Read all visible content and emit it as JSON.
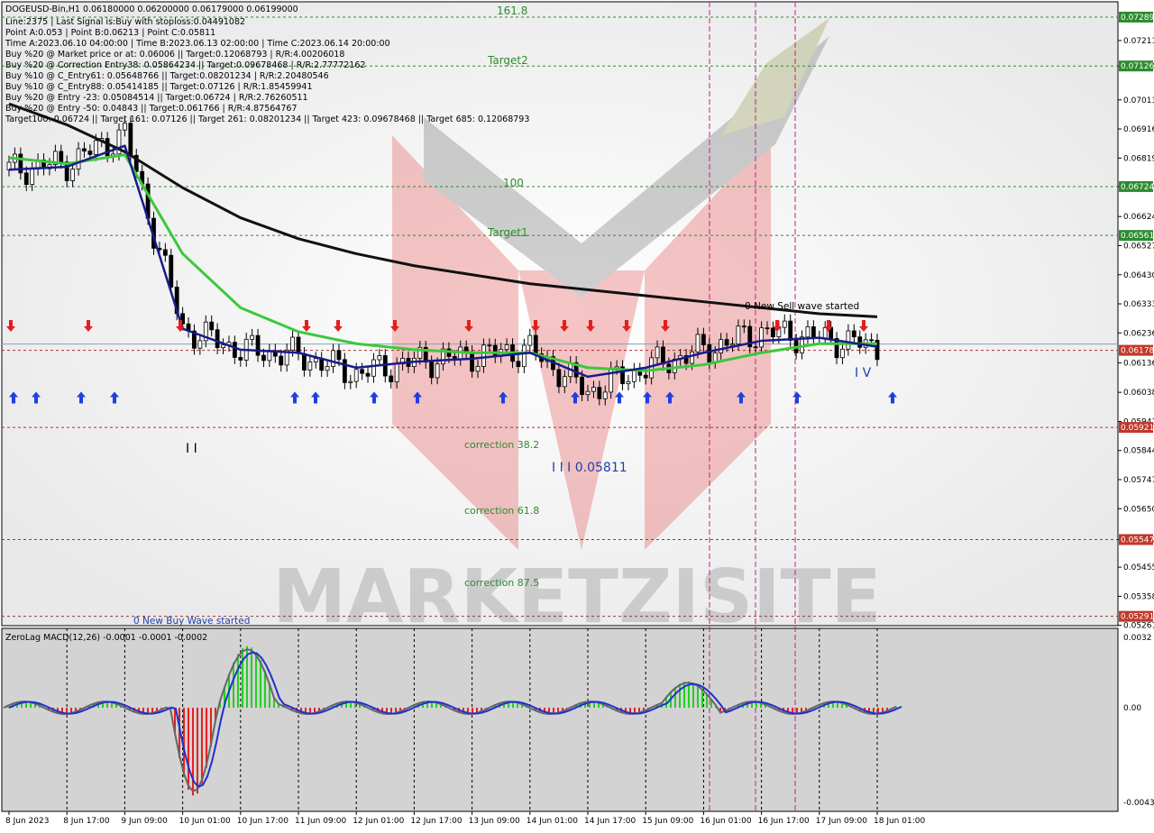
{
  "header": {
    "symbol_line": "DOGEUSD-Bin,H1  0.06180000 0.06200000 0.06179000 0.06199000",
    "lines": [
      "Line:2375 | Last Signal is:Buy with stoploss:0.04491082",
      "Point A:0.053 | Point B:0.06213 | Point C:0.05811",
      "Time A:2023.06.10 04:00:00 | Time B:2023.06.13 02:00:00 | Time C:2023.06.14 20:00:00",
      "Buy %20 @ Market price or at: 0.06006 || Target:0.12068793 | R/R:4.00206018",
      "Buy %20 @ Correction Entry38: 0.05864234 || Target:0.09678468 | R/R:2.77772162",
      "Buy %10 @ C_Entry61: 0.05648766 || Target:0.08201234 | R/R:2.20480546",
      "Buy %10 @ C_Entry88: 0.05414185 || Target:0.07126 | R/R:1.85459941",
      "Buy %20 @ Entry -23: 0.05084514 || Target:0.06724 | R/R:2.76260511",
      "Buy %20 @ Entry -50: 0.04843 || Target:0.061766 | R/R:4.87564767",
      "Target100: 0.06724 || Target 161: 0.07126 || Target 261: 0.08201234 || Target 423: 0.09678468 || Target 685: 0.12068793"
    ]
  },
  "watermark": "MARKETZISITE",
  "main_chart": {
    "price_axis_ticks": [
      "0.07211",
      "0.07126",
      "0.07013",
      "0.06916",
      "0.06819",
      "0.06724",
      "0.06624",
      "0.06527",
      "0.06430",
      "0.06333",
      "0.06236",
      "0.06136",
      "0.06038",
      "0.05941",
      "0.05844",
      "0.05747",
      "0.05650",
      "0.05547",
      "0.05455",
      "0.05358",
      "0.05261"
    ],
    "price_labels": [
      {
        "text": "0.07289",
        "value": 0.07289,
        "color": "#2e8b2e"
      },
      {
        "text": "0.07126",
        "value": 0.07126,
        "color": "#2e8b2e"
      },
      {
        "text": "0.06724",
        "value": 0.06724,
        "color": "#2e8b2e"
      },
      {
        "text": "0.06561",
        "value": 0.06561,
        "color": "#2e8b2e"
      },
      {
        "text": "0.06178",
        "value": 0.06178,
        "color": "#c0392b"
      },
      {
        "text": "0.05921",
        "value": 0.05921,
        "color": "#c0392b"
      },
      {
        "text": "0.05547",
        "value": 0.05547,
        "color": "#c0392b"
      },
      {
        "text": "0.05291",
        "value": 0.05291,
        "color": "#c0392b"
      }
    ],
    "green_levels": [
      {
        "value": 0.07289,
        "label": "161.8"
      },
      {
        "value": 0.07126,
        "label": "Target2"
      },
      {
        "value": 0.06724,
        "label": "100"
      },
      {
        "value": 0.06561,
        "label": "Target1"
      }
    ],
    "red_levels": [
      {
        "value": 0.06178
      },
      {
        "value": 0.05921,
        "label": "correction 38.2"
      },
      {
        "value": 0.05547,
        "label": "correction 61.8"
      },
      {
        "value": 0.05291,
        "label": "correction 87.5"
      }
    ],
    "annotations": {
      "sell_wave": "0 New Sell wave started",
      "buy_wave": "0 New Buy Wave started",
      "wave_label": "I I I 0.05811",
      "wave_iv": "I V",
      "wave_ii": "I I"
    }
  },
  "macd": {
    "title": "ZeroLag MACD(12,26) -0.0001 -0.0001 -0.0002",
    "axis_ticks": [
      "0.0032",
      "0.00",
      "-0.0043"
    ]
  },
  "time_axis": [
    "8 Jun 2023",
    "8 Jun 17:00",
    "9 Jun 09:00",
    "10 Jun 01:00",
    "10 Jun 17:00",
    "11 Jun 09:00",
    "12 Jun 01:00",
    "12 Jun 17:00",
    "13 Jun 09:00",
    "14 Jun 01:00",
    "14 Jun 17:00",
    "15 Jun 09:00",
    "16 Jun 01:00",
    "16 Jun 17:00",
    "17 Jun 09:00",
    "18 Jun 01:00"
  ],
  "chart_data": {
    "type": "line",
    "title": "DOGEUSD-Bin,H1",
    "x": [
      "8 Jun 2023",
      "8 Jun 17:00",
      "9 Jun 09:00",
      "10 Jun 01:00",
      "10 Jun 17:00",
      "11 Jun 09:00",
      "12 Jun 01:00",
      "12 Jun 17:00",
      "13 Jun 09:00",
      "14 Jun 01:00",
      "14 Jun 17:00",
      "15 Jun 09:00",
      "16 Jun 01:00",
      "16 Jun 17:00",
      "17 Jun 09:00",
      "18 Jun 01:00"
    ],
    "series": [
      {
        "values": [
          0.0678,
          0.068,
          0.069,
          0.0625,
          0.0618,
          0.0616,
          0.061,
          0.0614,
          0.0616,
          0.0618,
          0.0604,
          0.0612,
          0.0618,
          0.0624,
          0.0622,
          0.0619
        ]
      },
      {
        "values": [
          0.07,
          0.0693,
          0.0684,
          0.0672,
          0.0662,
          0.0655,
          0.065,
          0.0646,
          0.0643,
          0.064,
          0.0638,
          0.0636,
          0.0634,
          0.0632,
          0.063,
          0.0629
        ]
      },
      {
        "values": [
          0.0682,
          0.068,
          0.0683,
          0.065,
          0.0632,
          0.0624,
          0.062,
          0.0618,
          0.0617,
          0.0617,
          0.0612,
          0.0611,
          0.0613,
          0.0617,
          0.062,
          0.062
        ]
      },
      {
        "values": [
          0.0678,
          0.0679,
          0.0686,
          0.0625,
          0.0618,
          0.0617,
          0.0612,
          0.0614,
          0.0615,
          0.0617,
          0.0609,
          0.0612,
          0.0617,
          0.0621,
          0.0622,
          0.0619
        ]
      }
    ],
    "ylim": [
      0.0526,
      0.0734
    ],
    "macd_ylim": [
      -0.0043,
      0.0032
    ],
    "grid": false
  }
}
